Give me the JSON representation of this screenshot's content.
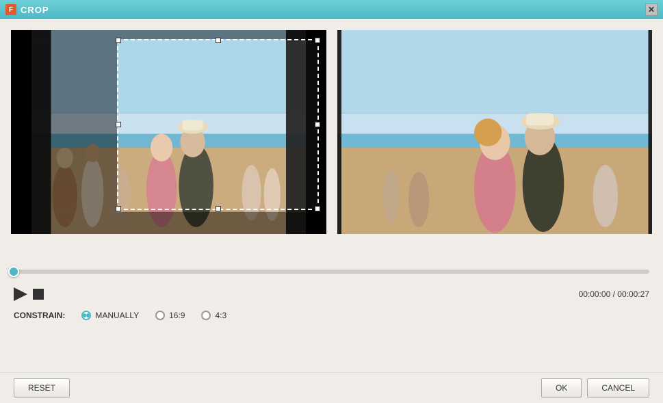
{
  "window": {
    "title": "CROP",
    "icon_label": "F"
  },
  "preview": {
    "left_label": "source-preview",
    "right_label": "output-preview"
  },
  "scrubber": {
    "position": 0,
    "fill_percent": 0
  },
  "transport": {
    "play_label": "▶",
    "stop_label": "■",
    "time_current": "00:00:00",
    "time_total": "00:00:27",
    "time_separator": " / ",
    "time_display": "00:00:00 / 00:00:27"
  },
  "constrain": {
    "label": "CONSTRAIN:",
    "options": [
      {
        "id": "manually",
        "label": "MANUALLY",
        "selected": true
      },
      {
        "id": "16-9",
        "label": "16:9",
        "selected": false
      },
      {
        "id": "4-3",
        "label": "4:3",
        "selected": false
      }
    ]
  },
  "buttons": {
    "reset_label": "RESET",
    "ok_label": "OK",
    "cancel_label": "CANCEL"
  },
  "colors": {
    "accent": "#4db8c4",
    "title_bg": "#4db8c4"
  }
}
